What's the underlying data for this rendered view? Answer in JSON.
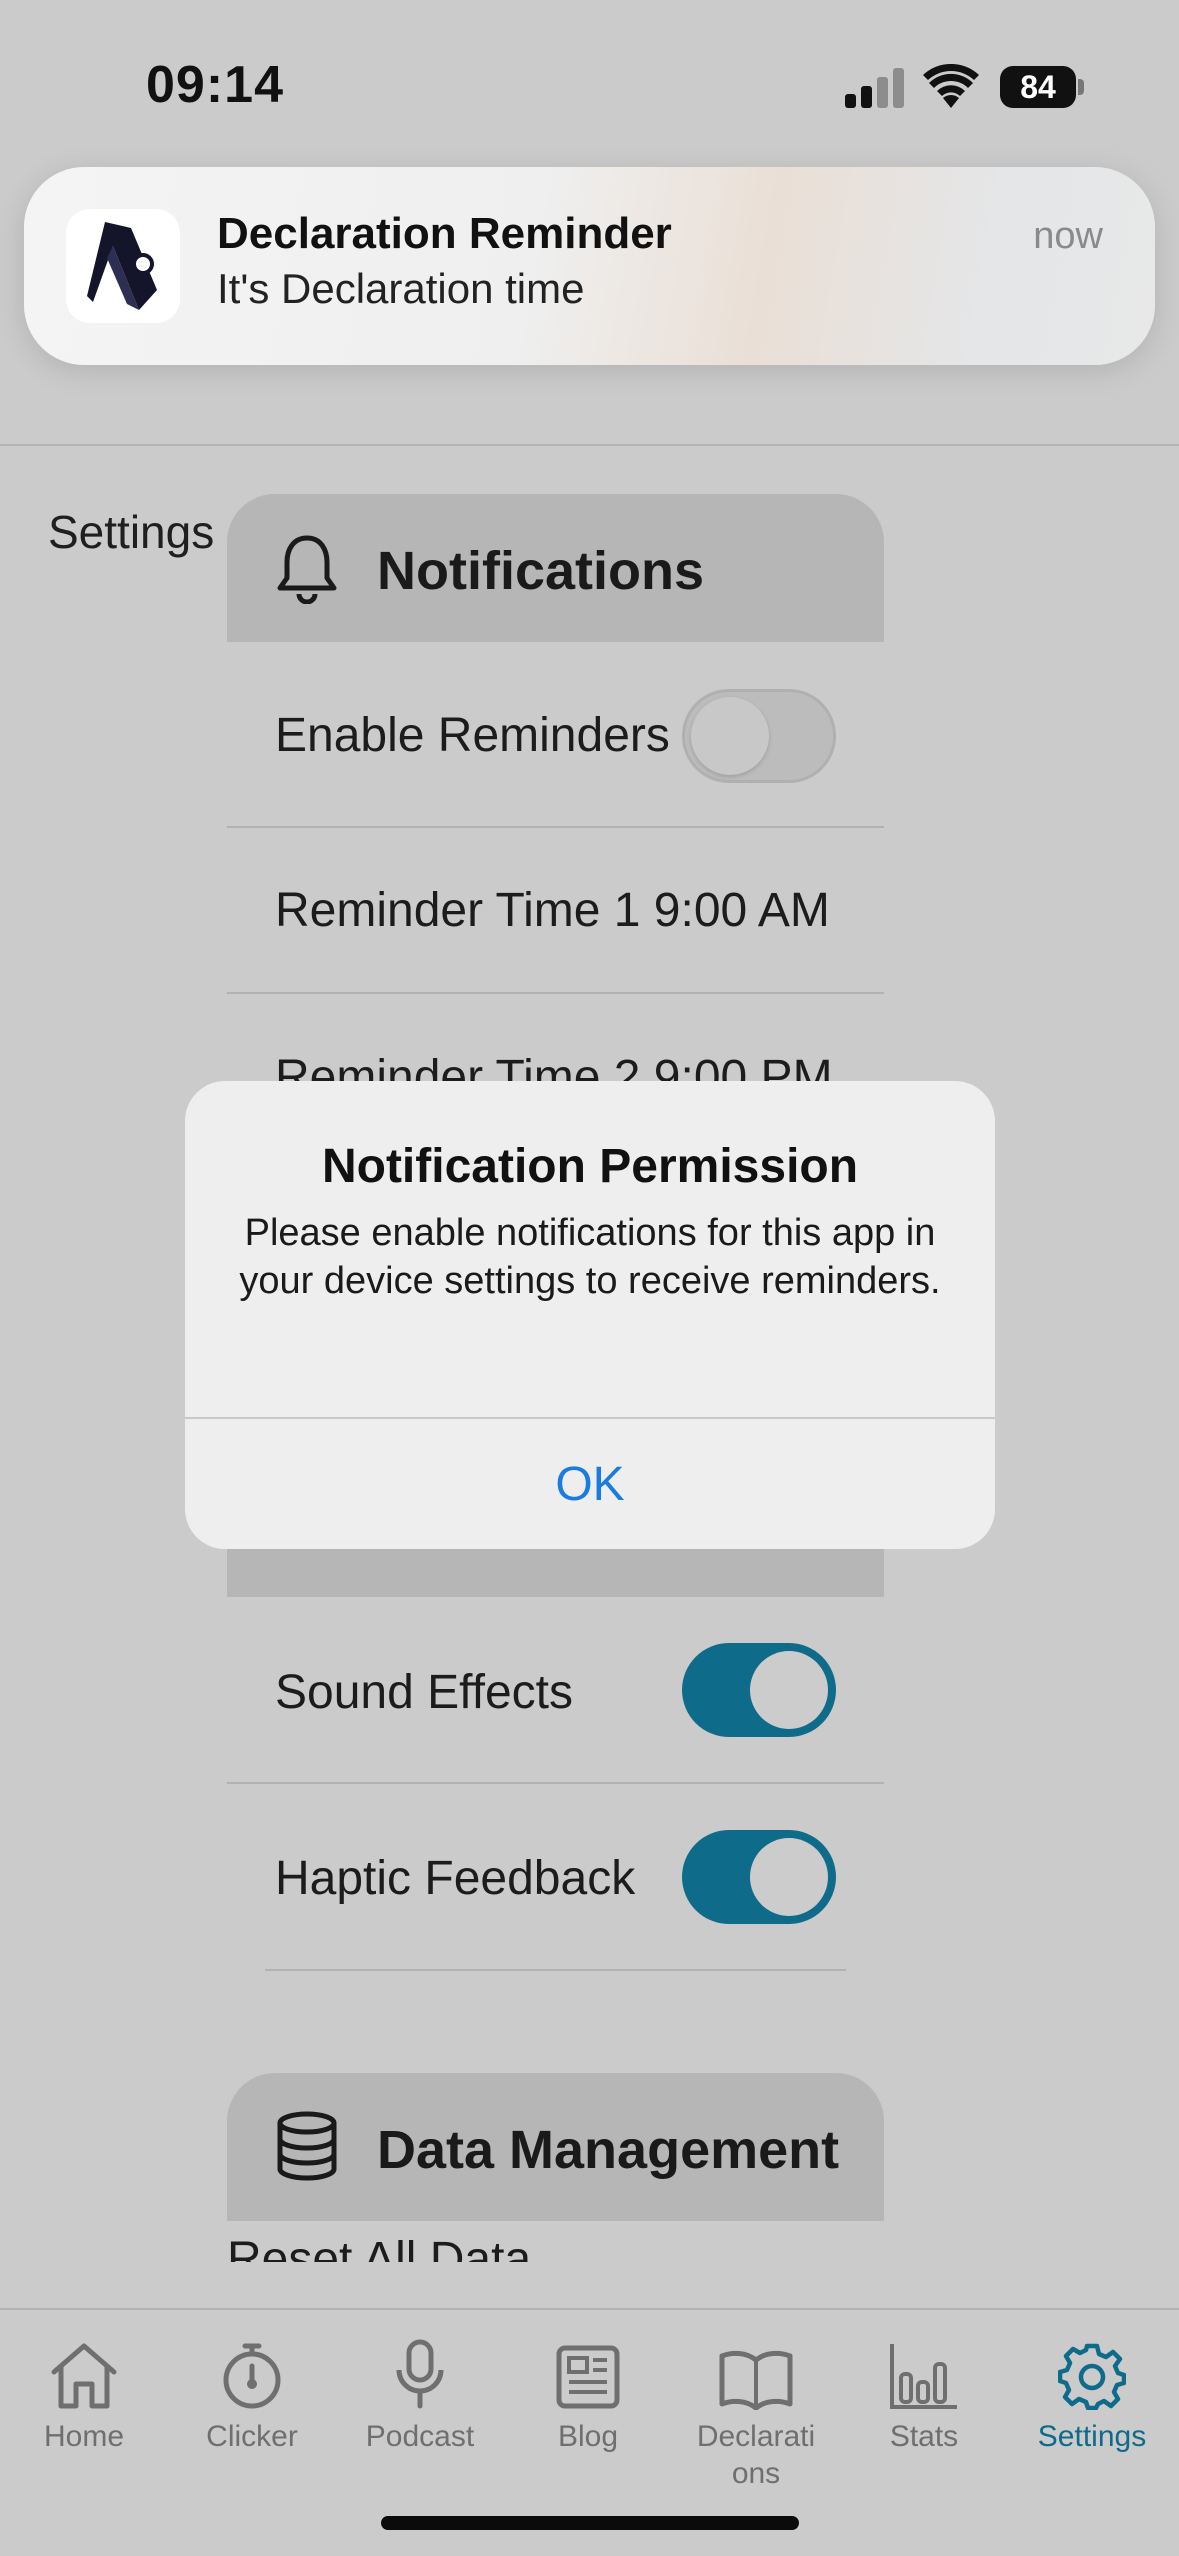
{
  "status_bar": {
    "time": "09:14",
    "battery": "84"
  },
  "banner": {
    "title": "Declaration Reminder",
    "body": "It's Declaration time",
    "time": "now"
  },
  "page": {
    "title": "Settings"
  },
  "notifications": {
    "header": "Notifications",
    "enable_reminders": "Enable Reminders",
    "reminder_time_1": "Reminder Time 1 9:00 AM",
    "reminder_time_2": "Reminder Time 2 9:00 PM"
  },
  "feedback": {
    "sound_effects": "Sound Effects",
    "haptic_feedback": "Haptic Feedback"
  },
  "data_management": {
    "header": "Data Management",
    "reset_all": "Reset All Data"
  },
  "toggles": {
    "enable_reminders": false,
    "sound_effects": true,
    "haptic_feedback": true
  },
  "dialog": {
    "title": "Notification Permission",
    "message": "Please enable notifications for this app in your device settings to receive reminders.",
    "ok": "OK"
  },
  "tabs": [
    {
      "label": "Home",
      "icon": "house-icon"
    },
    {
      "label": "Clicker",
      "icon": "stopwatch-icon"
    },
    {
      "label": "Podcast",
      "icon": "microphone-icon"
    },
    {
      "label": "Blog",
      "icon": "newspaper-icon"
    },
    {
      "label": "Declarati\nons",
      "icon": "book-icon"
    },
    {
      "label": "Stats",
      "icon": "bar-chart-icon"
    },
    {
      "label": "Settings",
      "icon": "gear-icon"
    }
  ],
  "colors": {
    "accent": "#0e6b8a",
    "dialog_button": "#1a7be0",
    "dimmed_background": "#cbcbcb"
  }
}
